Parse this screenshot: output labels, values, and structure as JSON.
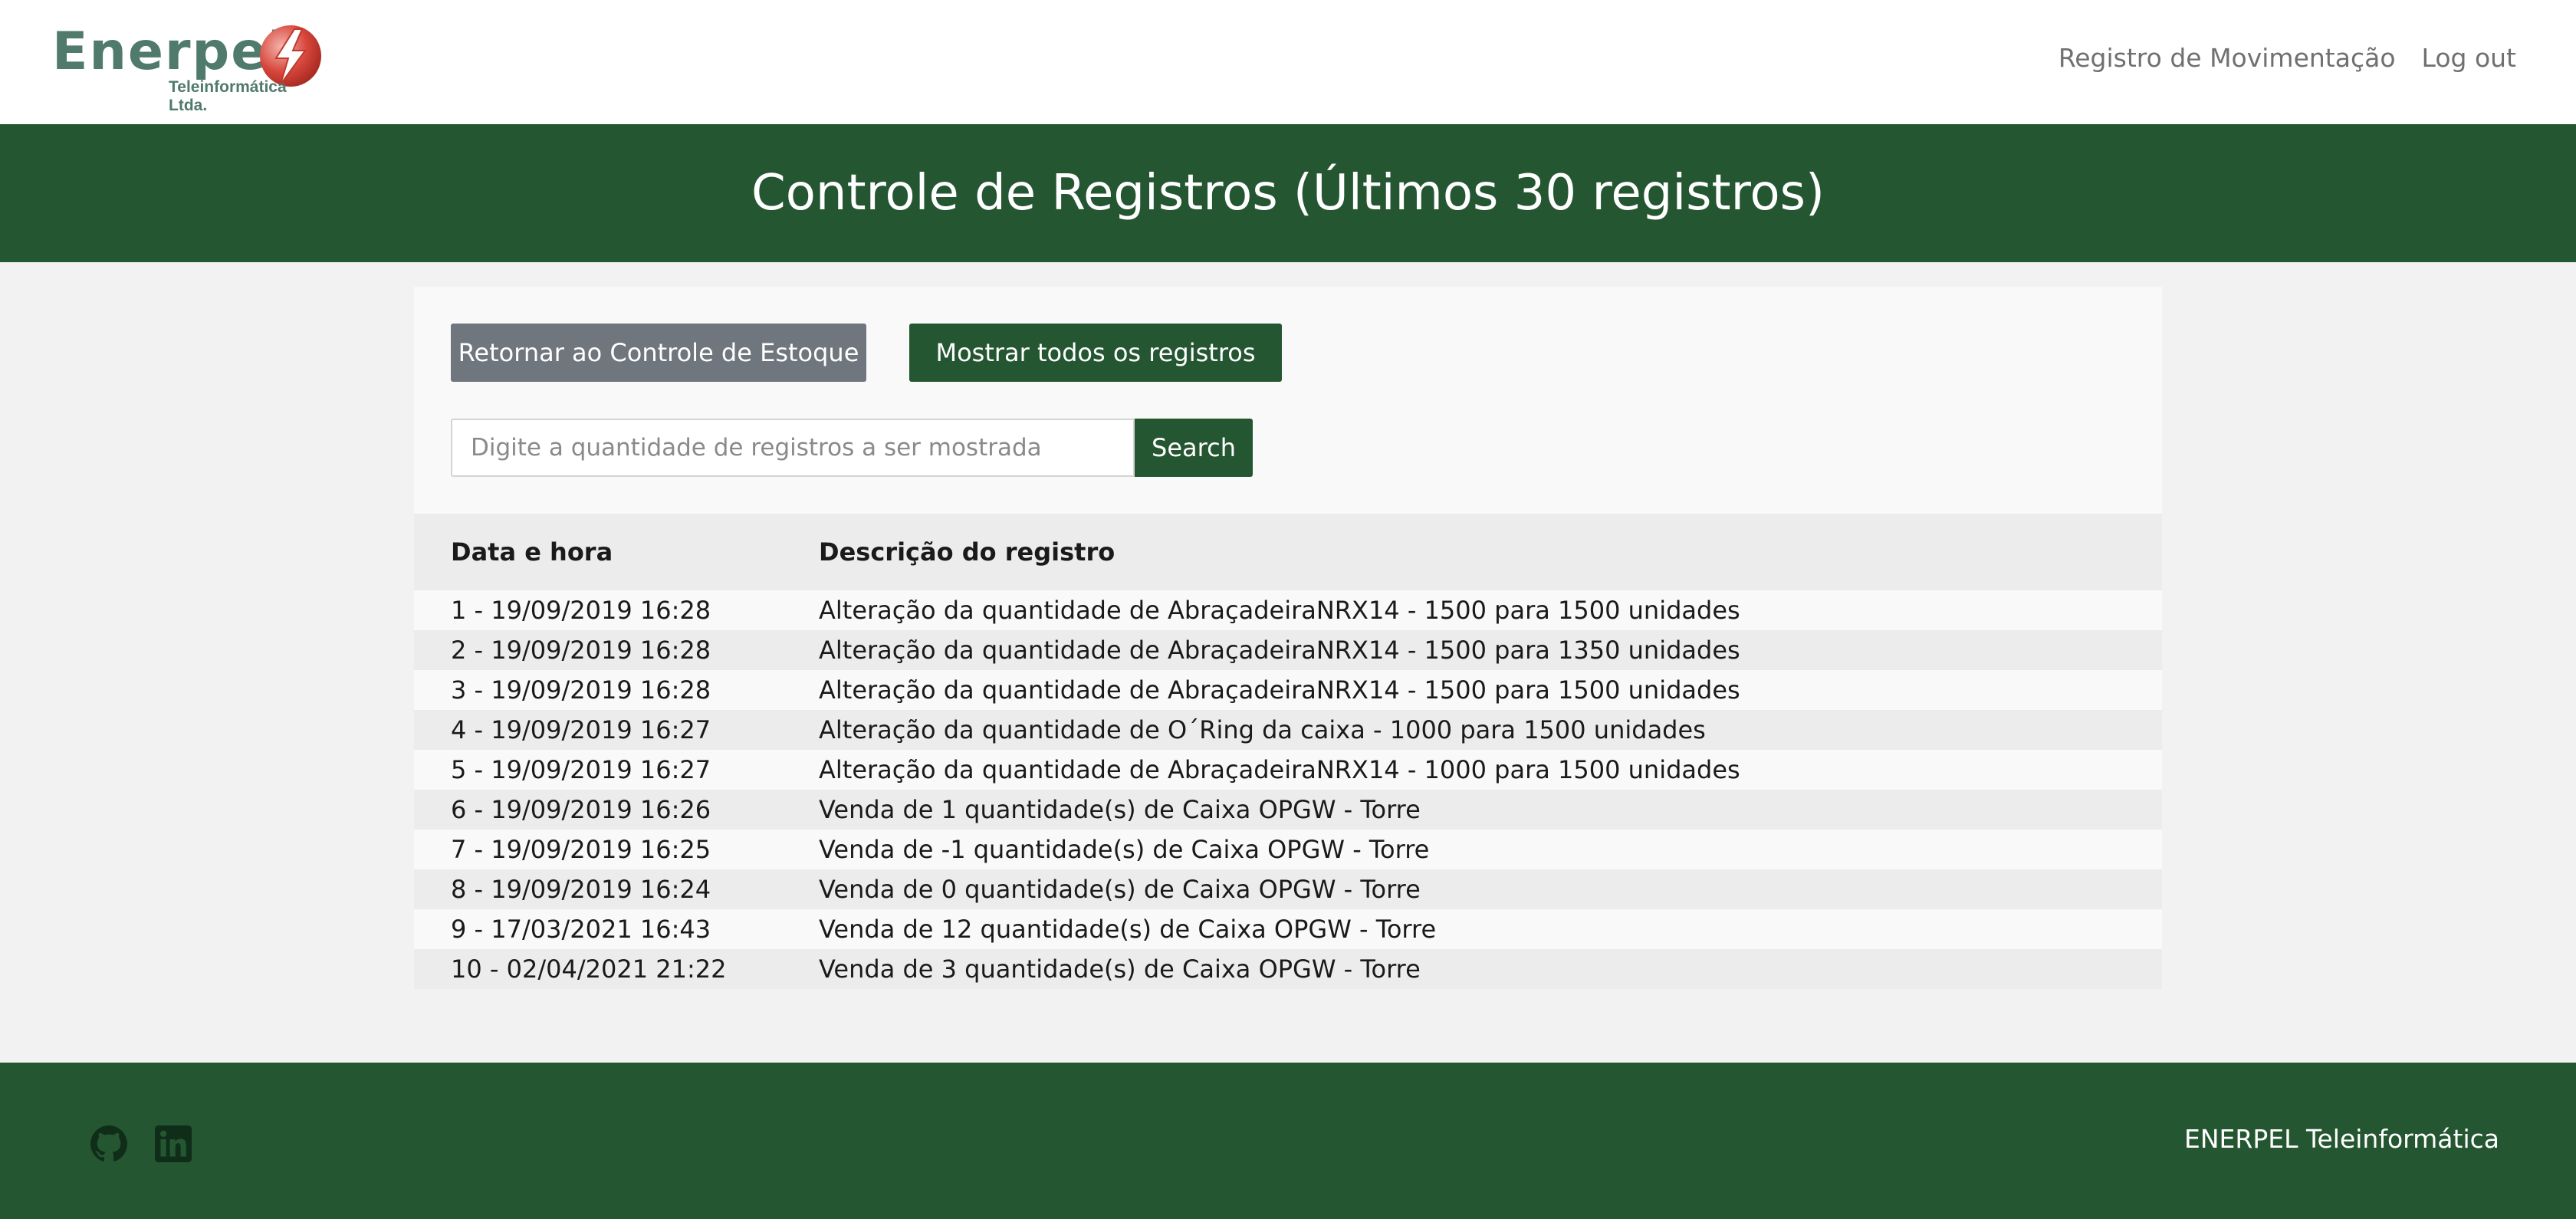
{
  "brand": {
    "name": "Enerpel",
    "subtitle": "Teleinformática Ltda.",
    "logo_colors": {
      "text": "#4f7a6c",
      "bolt": "#c0392b"
    }
  },
  "nav": {
    "items": [
      {
        "label": "Registro de Movimentação"
      },
      {
        "label": "Log out"
      }
    ]
  },
  "banner": {
    "title": "Controle de Registros (Últimos 30 registros)"
  },
  "actions": {
    "return_label": "Retornar ao Controle de Estoque",
    "show_all_label": "Mostrar todos os registros"
  },
  "search": {
    "placeholder": "Digite a quantidade de registros a ser mostrada",
    "value": "",
    "button_label": "Search"
  },
  "table": {
    "headers": [
      "Data e hora",
      "Descrição do registro"
    ],
    "rows": [
      {
        "datetime": "1 - 19/09/2019 16:28",
        "description": "Alteração da quantidade de AbraçadeiraNRX14 - 1500 para 1500 unidades"
      },
      {
        "datetime": "2 - 19/09/2019 16:28",
        "description": "Alteração da quantidade de AbraçadeiraNRX14 - 1500 para 1350 unidades"
      },
      {
        "datetime": "3 - 19/09/2019 16:28",
        "description": "Alteração da quantidade de AbraçadeiraNRX14 - 1500 para 1500 unidades"
      },
      {
        "datetime": "4 - 19/09/2019 16:27",
        "description": "Alteração da quantidade de O´Ring da caixa - 1000 para 1500 unidades"
      },
      {
        "datetime": "5 - 19/09/2019 16:27",
        "description": "Alteração da quantidade de AbraçadeiraNRX14 - 1000 para 1500 unidades"
      },
      {
        "datetime": "6 - 19/09/2019 16:26",
        "description": "Venda de 1 quantidade(s) de Caixa OPGW - Torre"
      },
      {
        "datetime": "7 - 19/09/2019 16:25",
        "description": "Venda de -1 quantidade(s) de Caixa OPGW - Torre"
      },
      {
        "datetime": "8 - 19/09/2019 16:24",
        "description": "Venda de 0 quantidade(s) de Caixa OPGW - Torre"
      },
      {
        "datetime": "9 - 17/03/2021 16:43",
        "description": "Venda de 12 quantidade(s) de Caixa OPGW - Torre"
      },
      {
        "datetime": "10 - 02/04/2021 21:22",
        "description": "Venda de 3 quantidade(s) de Caixa OPGW - Torre"
      }
    ]
  },
  "footer": {
    "icons": [
      "github-icon",
      "linkedin-icon"
    ],
    "brand": "ENERPEL Teleinformática"
  },
  "colors": {
    "primary_green": "#255632",
    "secondary_gray": "#6f767d",
    "page_bg": "#f2f2f2"
  }
}
